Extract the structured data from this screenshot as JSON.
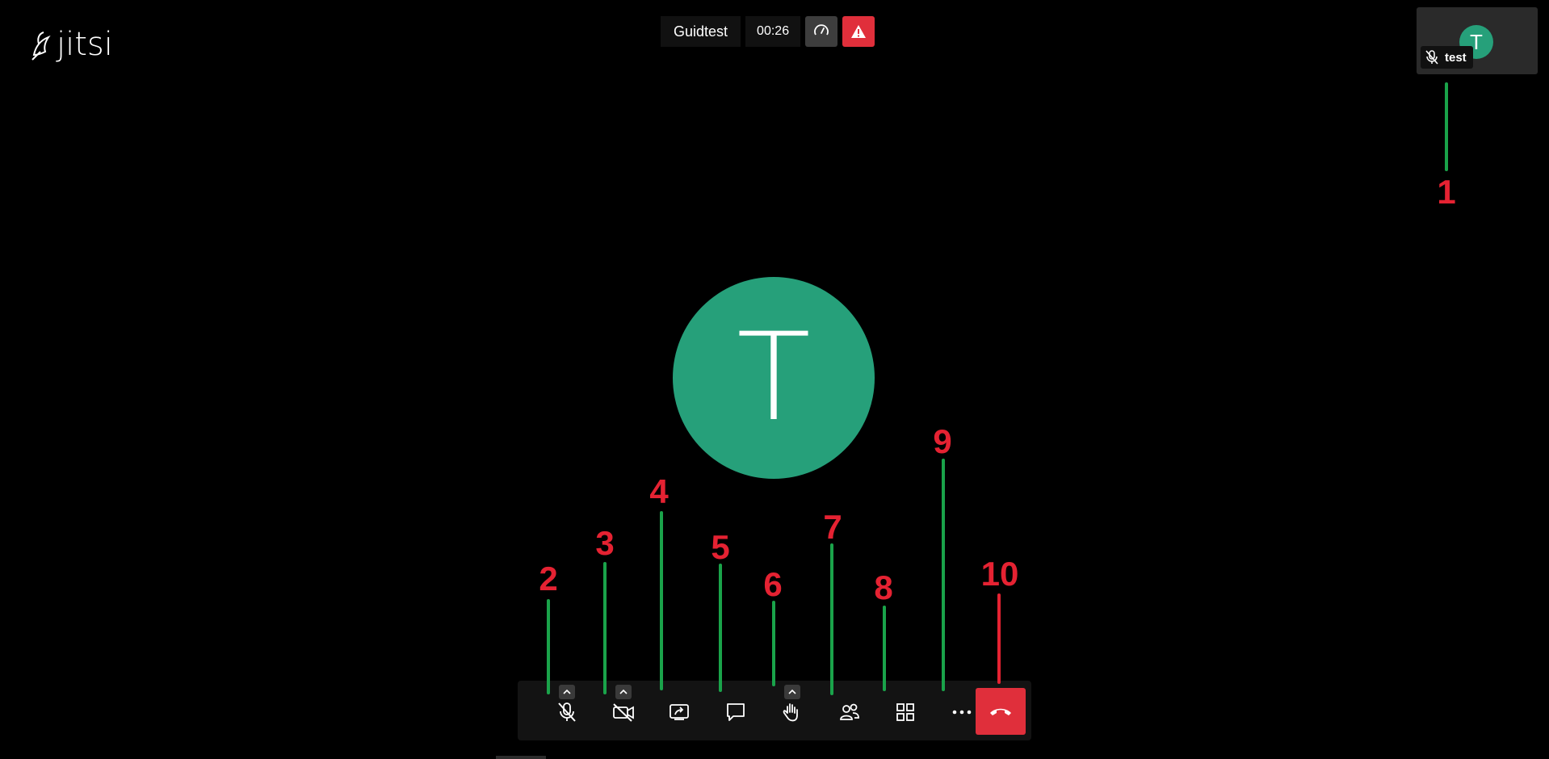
{
  "logo": {
    "text": "jitsi"
  },
  "header": {
    "room_name": "Guidtest",
    "timer": "00:26",
    "performance_icon": "gauge-icon",
    "warning_icon": "warning-icon"
  },
  "thumbnail": {
    "avatar_letter": "T",
    "participant_name": "test",
    "mic_state": "muted"
  },
  "main_avatar": {
    "letter": "T"
  },
  "toolbar": {
    "items": [
      {
        "name": "microphone",
        "icon": "mic-muted-icon",
        "has_caret": true
      },
      {
        "name": "camera",
        "icon": "camera-off-icon",
        "has_caret": true
      },
      {
        "name": "screen-share",
        "icon": "screen-share-icon",
        "has_caret": false
      },
      {
        "name": "chat",
        "icon": "chat-icon",
        "has_caret": false
      },
      {
        "name": "raise-hand",
        "icon": "hand-icon",
        "has_caret": true
      },
      {
        "name": "participants",
        "icon": "participants-icon",
        "has_caret": false
      },
      {
        "name": "tile-view",
        "icon": "grid-icon",
        "has_caret": false
      },
      {
        "name": "more",
        "icon": "more-icon",
        "has_caret": false
      },
      {
        "name": "hangup",
        "icon": "phone-hangup-icon",
        "has_caret": false
      }
    ]
  },
  "annotations": {
    "labels": [
      "1",
      "2",
      "3",
      "4",
      "5",
      "6",
      "7",
      "8",
      "9",
      "10"
    ],
    "colors": {
      "line": "#1aa34a",
      "hangup_line": "#e52232",
      "label": "#e52232"
    }
  },
  "colors": {
    "avatar": "#26a07a",
    "hangup": "#e02f3b",
    "toolbar_bg": "#131313"
  }
}
